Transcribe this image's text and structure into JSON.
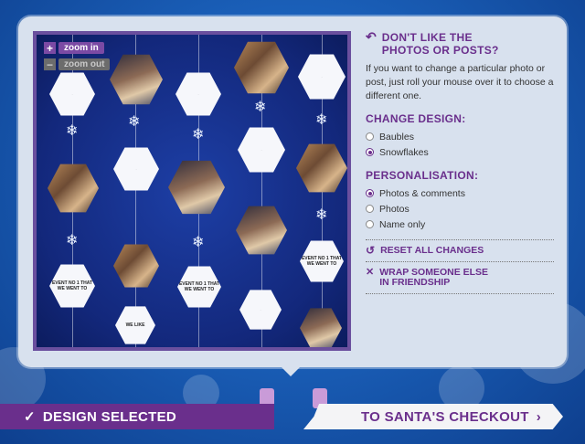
{
  "zoom": {
    "in_label": "zoom in",
    "out_label": "zoom out",
    "in_symbol": "+",
    "out_symbol": "−"
  },
  "side": {
    "photos_header_line1": "DON'T LIKE THE",
    "photos_header_line2": "PHOTOS OR POSTS?",
    "photos_text": "If you want to change a particular photo or post, just roll your mouse over it to choose a different one.",
    "design_header": "CHANGE DESIGN:",
    "design_options": [
      "Baubles",
      "Snowflakes"
    ],
    "design_selected": "Snowflakes",
    "personal_header": "PERSONALISATION:",
    "personal_options": [
      "Photos & comments",
      "Photos",
      "Name only"
    ],
    "personal_selected": "Photos & comments",
    "reset_label": "RESET ALL CHANGES",
    "wrap_line1": "WRAP SOMEONE ELSE",
    "wrap_line2": "IN FRIENDSHIP"
  },
  "footer": {
    "selected_label": "DESIGN SELECTED",
    "checkout_label": "TO SANTA'S CHECKOUT"
  },
  "card_snippets": {
    "event": "EVENT NO 1 THAT WE WENT TO",
    "we_like": "WE LIKE"
  },
  "colors": {
    "accent": "#6a2f8c",
    "panel": "#d8e1ee",
    "canvas": "#13287c"
  }
}
